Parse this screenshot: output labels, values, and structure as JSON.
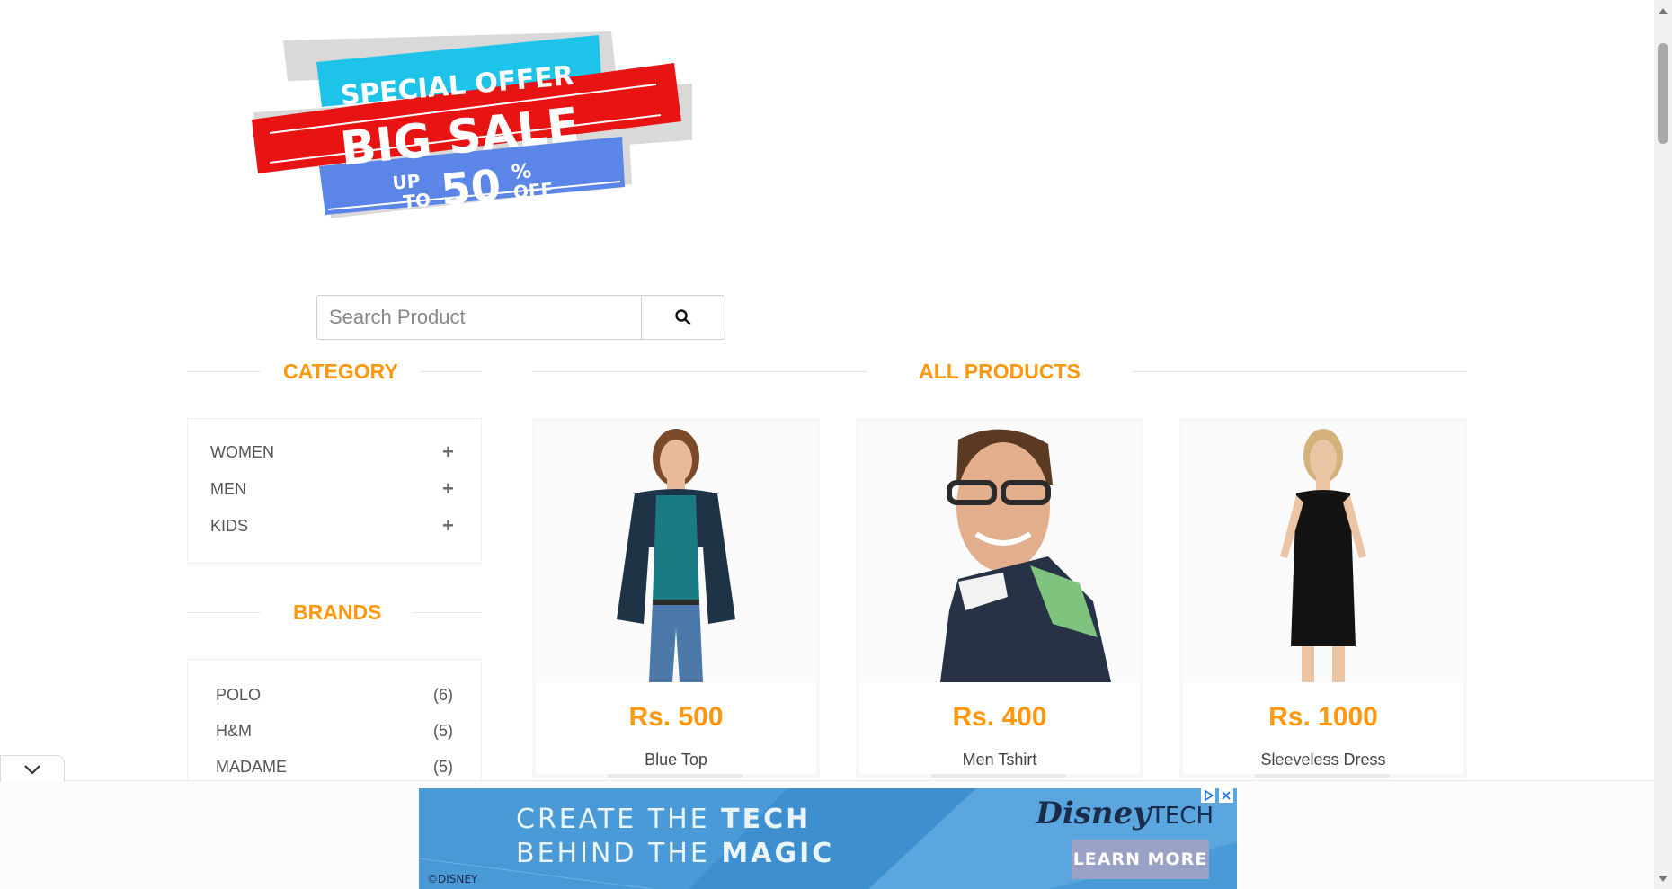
{
  "banner": {
    "line1": "SPECIAL OFFER",
    "line2": "BIG SALE",
    "line3_up": "UP",
    "line3_to": "TO",
    "line3_pct": "50",
    "line3_sym": "%",
    "line3_off": "OFF"
  },
  "search": {
    "placeholder": "Search Product",
    "button_icon": "search-icon"
  },
  "sidebar": {
    "category_title": "CATEGORY",
    "categories": [
      {
        "label": "WOMEN",
        "icon": "plus-icon"
      },
      {
        "label": "MEN",
        "icon": "plus-icon"
      },
      {
        "label": "KIDS",
        "icon": "plus-icon"
      }
    ],
    "brands_title": "BRANDS",
    "brands": [
      {
        "label": "POLO",
        "count": "(6)"
      },
      {
        "label": "H&M",
        "count": "(5)"
      },
      {
        "label": "MADAME",
        "count": "(5)"
      }
    ]
  },
  "main": {
    "title": "ALL PRODUCTS",
    "products": [
      {
        "price": "Rs. 500",
        "name": "Blue Top"
      },
      {
        "price": "Rs. 400",
        "name": "Men Tshirt"
      },
      {
        "price": "Rs. 1000",
        "name": "Sleeveless Dress"
      }
    ]
  },
  "ad": {
    "headline_1a": "CREATE THE ",
    "headline_1b": "TECH",
    "headline_2a": "BEHIND THE ",
    "headline_2b": "MAGIC",
    "brand": "Disney",
    "brand_suffix": "TECH",
    "cta": "LEARN MORE",
    "copyright": "©DISNEY"
  },
  "colors": {
    "accent": "#fe980f",
    "ad_background": "#4a9ad8"
  }
}
